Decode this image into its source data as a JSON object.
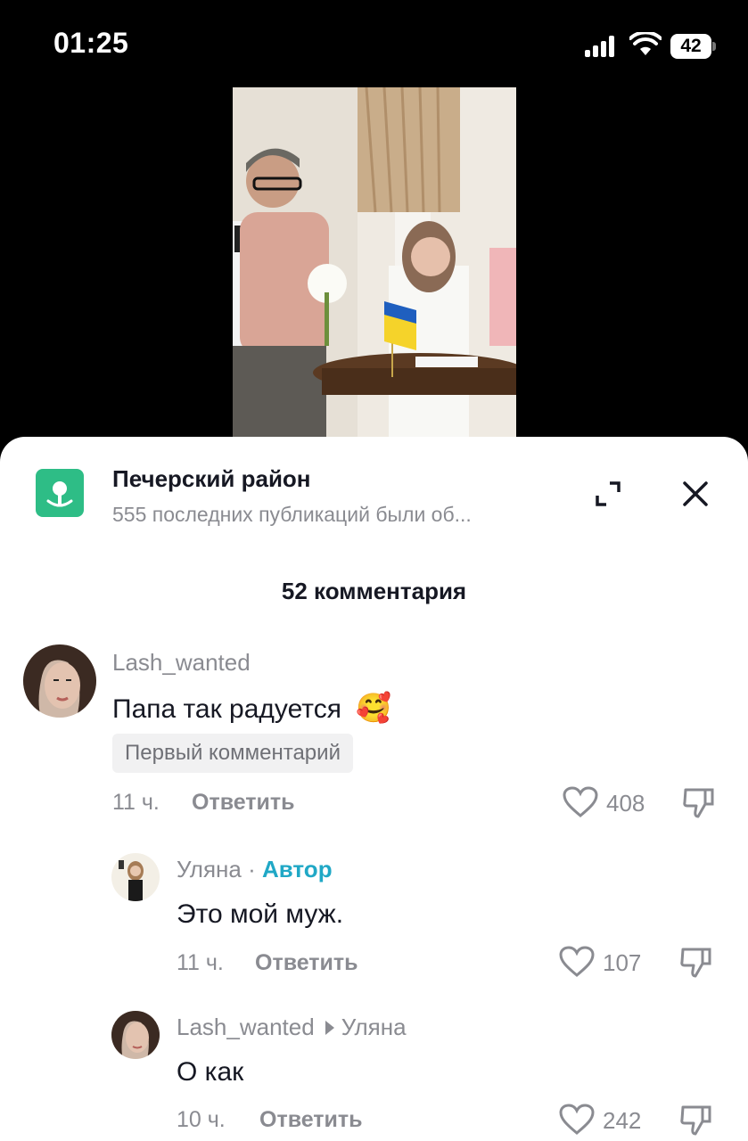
{
  "status_bar": {
    "time": "01:25",
    "battery": "42"
  },
  "location": {
    "title": "Печерский район",
    "subtitle": "555 последних публикаций были об..."
  },
  "comments_count": "52 комментария",
  "comments": [
    {
      "username": "Lash_wanted",
      "text": "Папа так радуется",
      "emoji": "🥰",
      "badge": "Первый комментарий",
      "time": "11 ч.",
      "reply": "Ответить",
      "likes": "408"
    },
    {
      "username": "Уляна",
      "separator": "·",
      "author_tag": "Автор",
      "text": "Это мой муж.",
      "time": "11 ч.",
      "reply": "Ответить",
      "likes": "107"
    },
    {
      "username": "Lash_wanted",
      "reply_to": "Уляна",
      "text": "О как",
      "time": "10 ч.",
      "reply": "Ответить",
      "likes": "242"
    }
  ],
  "colors": {
    "accent": "#20a8c6",
    "location_icon": "#2ebd86",
    "muted": "#8a8b91"
  }
}
